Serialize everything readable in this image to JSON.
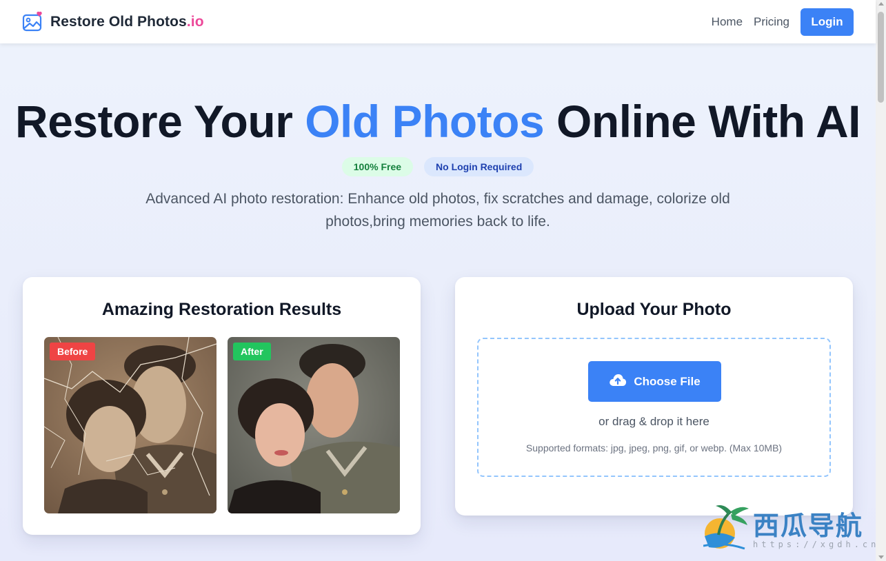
{
  "header": {
    "brand_name": "Restore Old Photos",
    "brand_suffix": ".io",
    "logo_icon": "image-heart-icon",
    "nav": [
      {
        "label": "Home"
      },
      {
        "label": "Pricing"
      }
    ],
    "login_label": "Login"
  },
  "hero": {
    "title_part1": "Restore Your ",
    "title_accent": "Old Photos",
    "title_part2": " Online With AI",
    "badge_free": "100% Free",
    "badge_login": "No Login Required",
    "subtitle": "Advanced AI photo restoration: Enhance old photos, fix scratches and damage, colorize old photos,bring memories back to life."
  },
  "results_card": {
    "title": "Amazing Restoration Results",
    "before_label": "Before",
    "after_label": "After"
  },
  "upload_card": {
    "title": "Upload Your Photo",
    "button_label": "Choose File",
    "button_icon": "cloud-upload-icon",
    "drag_text": "or drag & drop it here",
    "formats_text": "Supported formats: jpg, jpeg, png, gif, or webp. (Max 10MB)"
  },
  "watermark": {
    "text": "西瓜导航",
    "url": "https://xgdh.cn"
  },
  "colors": {
    "accent": "#3b82f6",
    "brand_suffix": "#ec4899",
    "before_tag": "#ef4444",
    "after_tag": "#22c55e"
  }
}
